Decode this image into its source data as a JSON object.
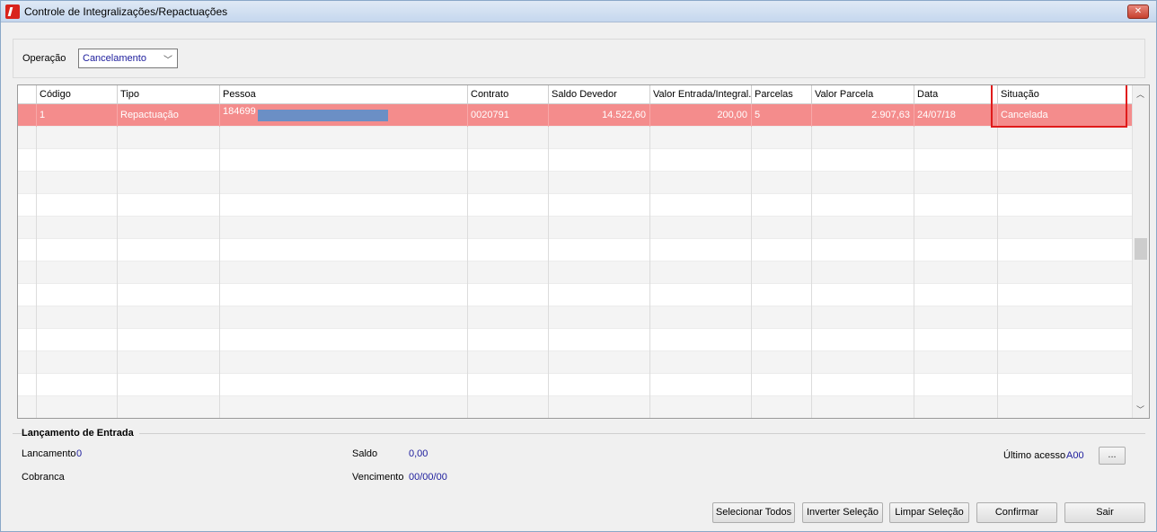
{
  "window": {
    "title": "Controle de Integralizações/Repactuações",
    "close_label": "✕"
  },
  "filter": {
    "operation_label": "Operação",
    "operation_value": "Cancelamento"
  },
  "grid": {
    "columns": [
      "Código",
      "Tipo",
      "Pessoa",
      "Contrato",
      "Saldo Devedor",
      "Valor Entrada/Integral...",
      "Parcelas",
      "Valor Parcela",
      "Data",
      "Situação"
    ],
    "rows": [
      {
        "codigo": "1",
        "tipo": "Repactuação",
        "pessoa": "184699",
        "contrato": "0020791",
        "saldo_devedor": "14.522,60",
        "valor_entrada": "200,00",
        "parcelas": "5",
        "valor_parcela": "2.907,63",
        "data": "24/07/18",
        "situacao": "Cancelada"
      }
    ]
  },
  "entry": {
    "title": "Lançamento de Entrada",
    "lancamento_label": "Lancamento",
    "lancamento_value": "0",
    "cobranca_label": "Cobranca",
    "saldo_label": "Saldo",
    "saldo_value": "0,00",
    "vencimento_label": "Vencimento",
    "vencimento_value": "00/00/00",
    "ultimo_acesso_label": "Último acesso",
    "ultimo_acesso_value": "A00",
    "dots_label": "..."
  },
  "buttons": {
    "select_all": "Selecionar Todos",
    "invert": "Inverter Seleção",
    "clear": "Limpar Seleção",
    "confirm": "Confirmar",
    "exit": "Sair"
  },
  "colors": {
    "selected_row": "#f48c8c",
    "highlight_box": "#e01b1b",
    "value_text": "#1c1c9c"
  }
}
